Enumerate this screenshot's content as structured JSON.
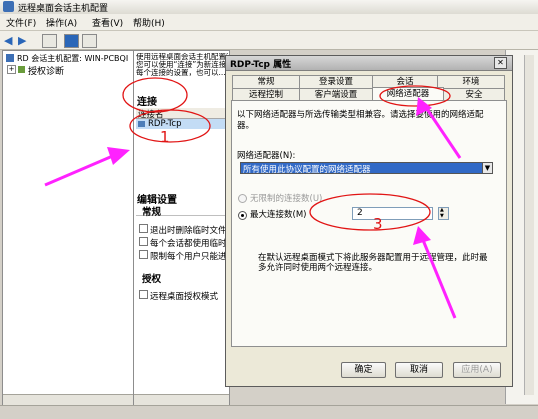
{
  "window": {
    "title": "远程桌面会话主机配置"
  },
  "menu": [
    "文件(F)",
    "操作(A)",
    "查看(V)",
    "帮助(H)"
  ],
  "tree": {
    "root": "RD 会话主机配置: WIN-PCBQI",
    "child": "授权诊断"
  },
  "middle": {
    "desc": [
      "使用远程桌面会话主机配置管理连接，",
      "您可以使用“连接”为新连接配置，",
      "每个连接的设置，也可以..."
    ],
    "connections_header": "连接",
    "conn_col": "连接名",
    "conn_item": "RDP-Tcp",
    "edit_header": "编辑设置",
    "general_header": "常规",
    "items": [
      "退出时删除临时文件",
      "每个会话都使用临时",
      "限制每个用户只能进"
    ],
    "license_header": "授权",
    "license_item": "远程桌面授权模式"
  },
  "dialog": {
    "title": "RDP-Tcp 属性",
    "tabs_row1": [
      "常规",
      "登录设置",
      "会话",
      "环境"
    ],
    "tabs_row2": [
      "远程控制",
      "客户端设置",
      "网络适配器",
      "安全"
    ],
    "desc": "以下网络适配器与所选传输类型相兼容。请选择要使用的网络适配器。",
    "adapter_label": "网络适配器(N):",
    "adapter_value": "所有使用此协议配置的网络适配器",
    "radio_unlimited": "无限制的连接数(U)",
    "radio_max": "最大连接数(M)",
    "max_value": "2",
    "note": "在默认远程桌面模式下将此服务器配置用于远程管理，此时最多允许同时使用两个远程连接。",
    "buttons": {
      "ok": "确定",
      "cancel": "取消",
      "apply": "应用(A)"
    }
  },
  "annotations": {
    "one": "1",
    "three": "3"
  },
  "colors": {
    "arrow": "#ff22ff",
    "marker": "#e11414"
  }
}
